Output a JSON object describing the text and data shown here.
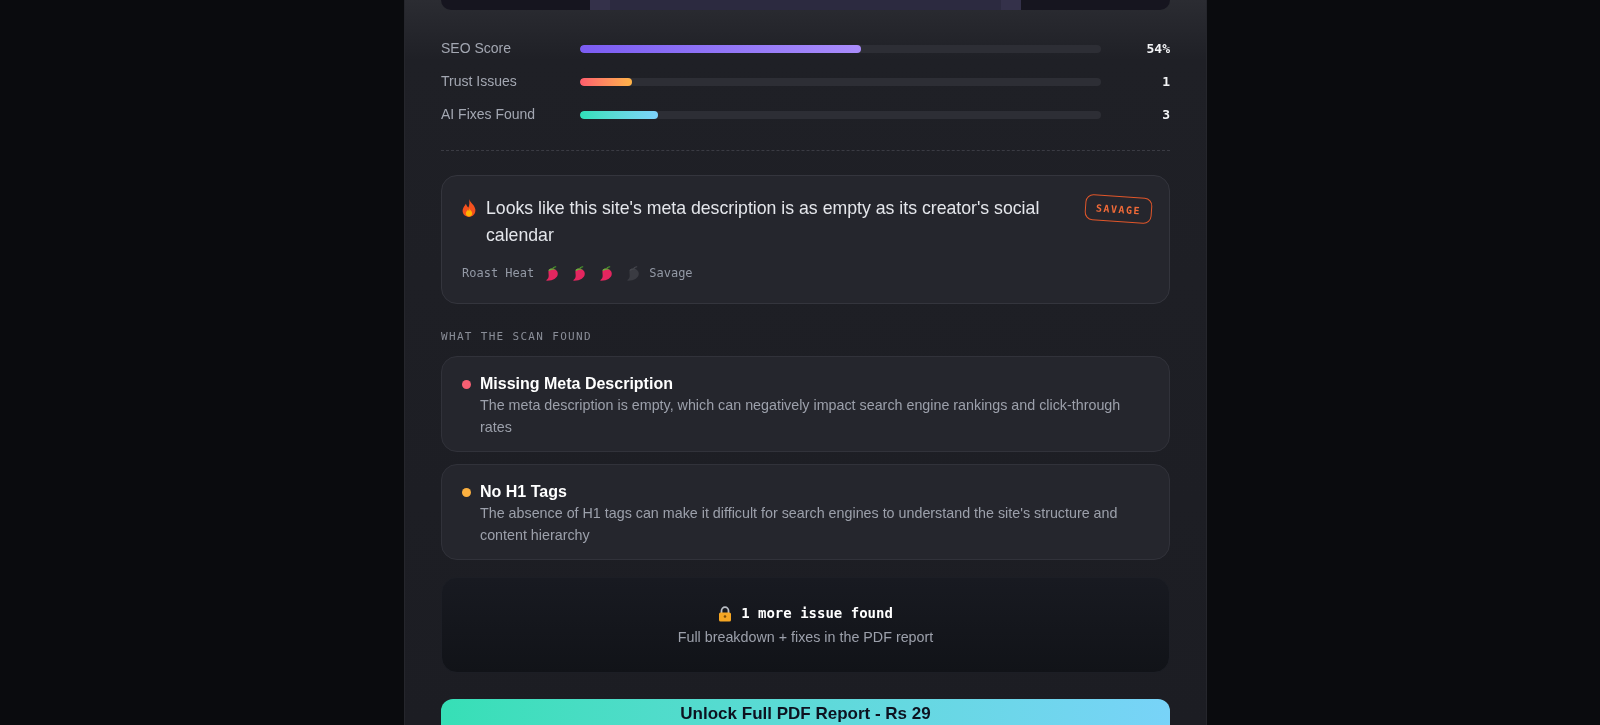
{
  "metrics": [
    {
      "label": "SEO Score",
      "kind": "score",
      "level": 0.54,
      "value": "54%"
    },
    {
      "label": "Trust Issues",
      "kind": "trust",
      "level": 0.1,
      "value": "1"
    },
    {
      "label": "AI Fixes Found",
      "kind": "fixes",
      "level": 0.15,
      "value": "3"
    }
  ],
  "roast": {
    "text": "Looks like this site's meta description is as empty as its creator's social calendar",
    "badge": "SAVAGE",
    "heat_label": "Roast Heat",
    "stars": 3,
    "heat_name": "Savage"
  },
  "scan_heading": "WHAT THE SCAN FOUND",
  "issues": [
    {
      "title": "Missing Meta Description",
      "description": "The meta description is empty, which can negatively impact search engine rankings and click-through rates",
      "color": "#f75f73"
    },
    {
      "title": "No H1 Tags",
      "description": "The absence of H1 tags can make it difficult for search engines to understand the site's structure and content hierarchy",
      "color": "#fbb040"
    }
  ],
  "locked": {
    "title": "1 more issue found",
    "subtitle": "Full breakdown + fixes in the PDF report"
  },
  "cta": {
    "label": "Unlock Full PDF Report - Rs 29"
  }
}
